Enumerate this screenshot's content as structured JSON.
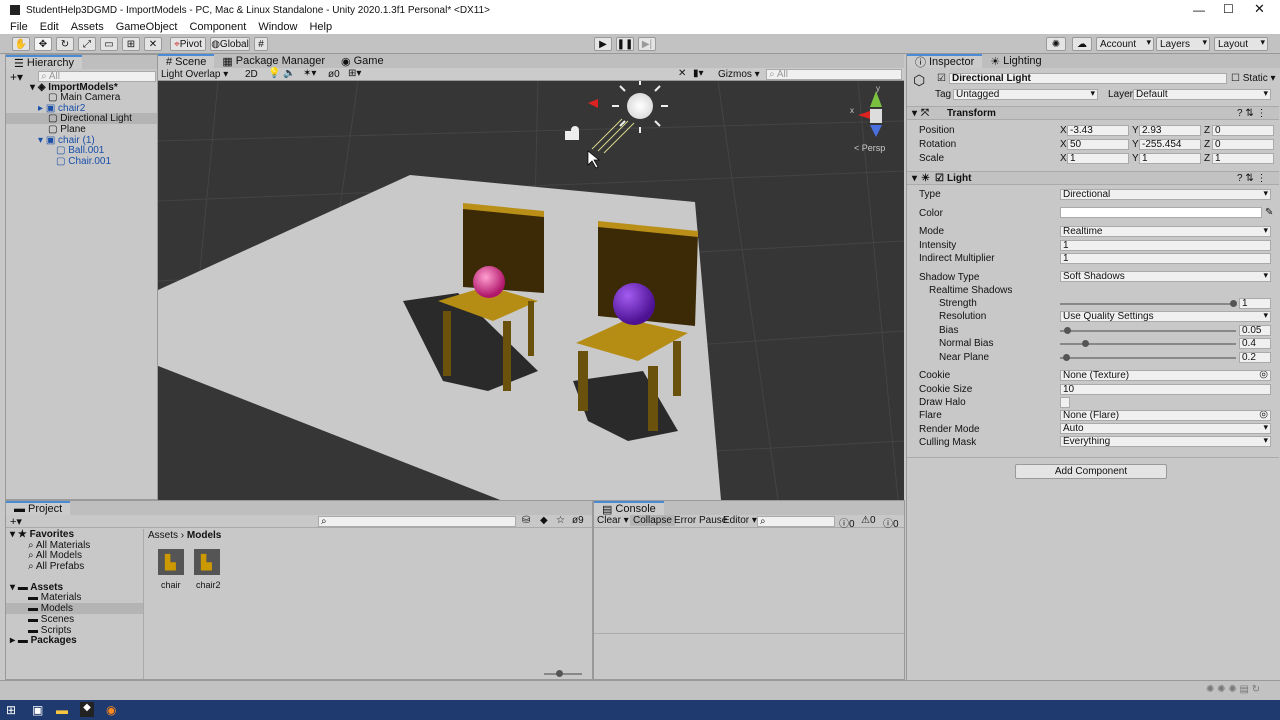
{
  "window": {
    "title": "StudentHelp3DGMD - ImportModels - PC, Mac & Linux Standalone - Unity 2020.1.3f1 Personal* <DX11>"
  },
  "menu": [
    "File",
    "Edit",
    "Assets",
    "GameObject",
    "Component",
    "Window",
    "Help"
  ],
  "toolbar": {
    "pivot": "Pivot",
    "global": "Global",
    "account": "Account",
    "layers": "Layers",
    "layout": "Layout"
  },
  "hierarchy": {
    "tab": "Hierarchy",
    "search_placeholder": "All",
    "items": [
      {
        "label": "ImportModels*",
        "indent": 0
      },
      {
        "label": "Main Camera",
        "indent": 1
      },
      {
        "label": "chair2",
        "indent": 1
      },
      {
        "label": "Directional Light",
        "indent": 1
      },
      {
        "label": "Plane",
        "indent": 1
      },
      {
        "label": "chair (1)",
        "indent": 1
      },
      {
        "label": "Ball.001",
        "indent": 2
      },
      {
        "label": "Chair.001",
        "indent": 2
      }
    ]
  },
  "scene": {
    "tabs": [
      "Scene",
      "Package Manager",
      "Game"
    ],
    "shading": "Light Overlap",
    "mode2d": "2D",
    "layers_count": "0",
    "gizmos": "Gizmos",
    "search_placeholder": "All",
    "persp": "< Persp",
    "axis": {
      "x": "x",
      "y": "y"
    }
  },
  "inspector": {
    "tabs": [
      "Inspector",
      "Lighting"
    ],
    "object_name": "Directional Light",
    "static": "Static",
    "tag_label": "Tag",
    "tag": "Untagged",
    "layer_label": "Layer",
    "layer": "Default",
    "transform": {
      "title": "Transform",
      "position_label": "Position",
      "position": {
        "x": "-3.43",
        "y": "2.93",
        "z": "0"
      },
      "rotation_label": "Rotation",
      "rotation": {
        "x": "50",
        "y": "-255.454",
        "z": "0"
      },
      "scale_label": "Scale",
      "scale": {
        "x": "1",
        "y": "1",
        "z": "1"
      },
      "axis": {
        "x": "X",
        "y": "Y",
        "z": "Z"
      }
    },
    "light": {
      "title": "Light",
      "type_label": "Type",
      "type": "Directional",
      "color_label": "Color",
      "mode_label": "Mode",
      "mode": "Realtime",
      "intensity_label": "Intensity",
      "intensity": "1",
      "indirect_label": "Indirect Multiplier",
      "indirect": "1",
      "shadow_type_label": "Shadow Type",
      "shadow_type": "Soft Shadows",
      "realtime_shadows": "Realtime Shadows",
      "strength_label": "Strength",
      "strength": "1",
      "strength_level": 1.0,
      "resolution_label": "Resolution",
      "resolution": "Use Quality Settings",
      "bias_label": "Bias",
      "bias": "0.05",
      "bias_level": 0.025,
      "normal_bias_label": "Normal Bias",
      "normal_bias": "0.4",
      "normal_bias_level": 0.13,
      "near_plane_label": "Near Plane",
      "near_plane": "0.2",
      "near_plane_level": 0.02,
      "cookie_label": "Cookie",
      "cookie": "None (Texture)",
      "cookie_size_label": "Cookie Size",
      "cookie_size": "10",
      "draw_halo_label": "Draw Halo",
      "flare_label": "Flare",
      "flare": "None (Flare)",
      "render_mode_label": "Render Mode",
      "render_mode": "Auto",
      "culling_label": "Culling Mask",
      "culling": "Everything"
    },
    "add_component": "Add Component"
  },
  "project": {
    "tab": "Project",
    "favorites": "Favorites",
    "fav_items": [
      "All Materials",
      "All Models",
      "All Prefabs"
    ],
    "assets": "Assets",
    "asset_folders": [
      "Materials",
      "Models",
      "Scenes",
      "Scripts"
    ],
    "packages": "Packages",
    "breadcrumb": [
      "Assets",
      "Models"
    ],
    "files": [
      "chair",
      "chair2"
    ],
    "hidden_count": "9"
  },
  "console": {
    "tab": "Console",
    "clear": "Clear",
    "collapse": "Collapse",
    "error_pause": "Error Pause",
    "editor": "Editor",
    "counts": [
      "0",
      "0",
      "0"
    ]
  }
}
